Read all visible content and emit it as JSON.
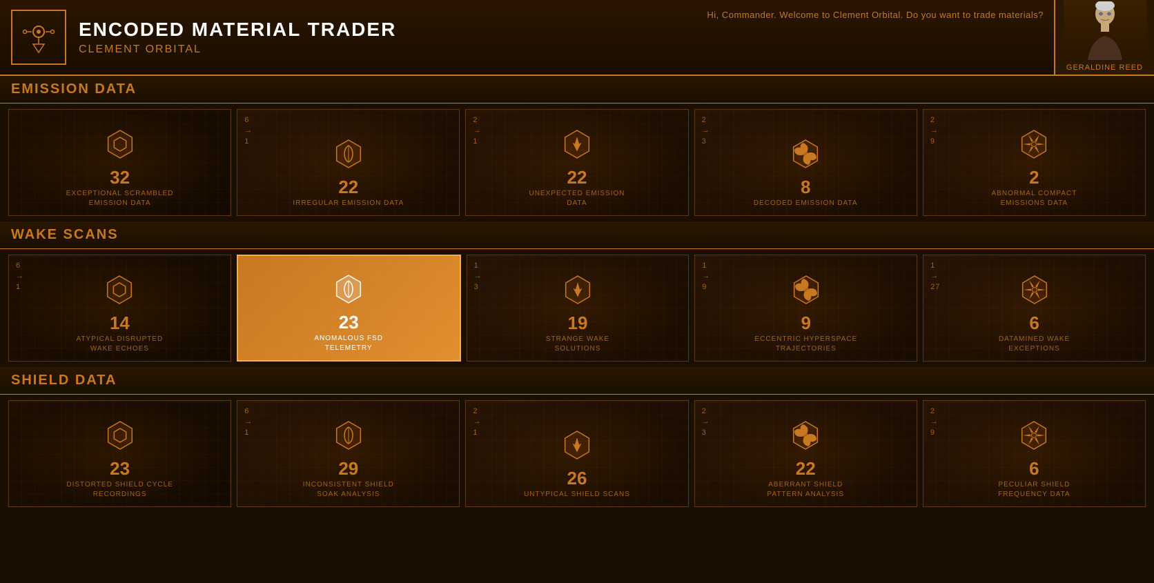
{
  "header": {
    "title": "ENCODED MATERIAL TRADER",
    "subtitle": "CLEMENT ORBITAL",
    "greeting": "Hi, Commander. Welcome to Clement Orbital. Do you want to trade materials?",
    "npc_name": "GERALDINE REED",
    "logo_label": "encoded-material-trader-logo"
  },
  "sections": [
    {
      "id": "emission-data",
      "label": "EMISSION DATA",
      "cards": [
        {
          "id": "exceptional-scrambled",
          "number": "32",
          "label": "EXCEPTIONAL SCRAMBLED\nEMISSION DATA",
          "ratio_top": "",
          "ratio_bottom": "",
          "icon_type": "hex-plain",
          "active": false
        },
        {
          "id": "irregular-emission",
          "number": "22",
          "label": "IRREGULAR EMISSION DATA",
          "ratio_top": "6",
          "ratio_bottom": "1",
          "icon_type": "hex-leaf",
          "active": false
        },
        {
          "id": "unexpected-emission",
          "number": "22",
          "label": "UNEXPECTED EMISSION\nDATA",
          "ratio_top": "2",
          "ratio_bottom": "1",
          "icon_type": "hex-flame",
          "active": false
        },
        {
          "id": "decoded-emission",
          "number": "8",
          "label": "DECODED EMISSION DATA",
          "ratio_top": "2",
          "ratio_bottom": "3",
          "icon_type": "hex-fan4",
          "active": false
        },
        {
          "id": "abnormal-compact",
          "number": "2",
          "label": "ABNORMAL COMPACT\nEMISSIONS DATA",
          "ratio_top": "2",
          "ratio_bottom": "9",
          "icon_type": "hex-fan6",
          "active": false
        }
      ]
    },
    {
      "id": "wake-scans",
      "label": "WAKE SCANS",
      "cards": [
        {
          "id": "atypical-disrupted",
          "number": "14",
          "label": "ATYPICAL DISRUPTED\nWAKE ECHOES",
          "ratio_top": "6",
          "ratio_bottom": "1",
          "icon_type": "hex-plain",
          "active": false
        },
        {
          "id": "anomalous-fsd",
          "number": "23",
          "label": "ANOMALOUS FSD\nTELEMETRY",
          "ratio_top": "",
          "ratio_bottom": "",
          "icon_type": "hex-leaf",
          "active": true
        },
        {
          "id": "strange-wake",
          "number": "19",
          "label": "STRANGE WAKE\nSOLUTIONS",
          "ratio_top": "1",
          "ratio_bottom": "3",
          "icon_type": "hex-flame",
          "active": false
        },
        {
          "id": "eccentric-hyperspace",
          "number": "9",
          "label": "ECCENTRIC HYPERSPACE\nTRAJECTORIES",
          "ratio_top": "1",
          "ratio_bottom": "9",
          "icon_type": "hex-fan4",
          "active": false
        },
        {
          "id": "datamined-wake",
          "number": "6",
          "label": "DATAMINED WAKE\nEXCEPTIONS",
          "ratio_top": "1",
          "ratio_bottom": "27",
          "icon_type": "hex-fan6",
          "active": false
        }
      ]
    },
    {
      "id": "shield-data",
      "label": "SHIELD DATA",
      "cards": [
        {
          "id": "distorted-shield",
          "number": "23",
          "label": "DISTORTED SHIELD CYCLE\nRECORDINGS",
          "ratio_top": "",
          "ratio_bottom": "",
          "icon_type": "hex-plain",
          "active": false
        },
        {
          "id": "inconsistent-shield",
          "number": "29",
          "label": "INCONSISTENT SHIELD\nSOAK ANALYSIS",
          "ratio_top": "6",
          "ratio_bottom": "1",
          "icon_type": "hex-leaf",
          "active": false
        },
        {
          "id": "untypical-shield",
          "number": "26",
          "label": "UNTYPICAL SHIELD SCANS",
          "ratio_top": "2",
          "ratio_bottom": "1",
          "icon_type": "hex-flame",
          "active": false
        },
        {
          "id": "aberrant-shield",
          "number": "22",
          "label": "ABERRANT SHIELD\nPATTERN ANALYSIS",
          "ratio_top": "2",
          "ratio_bottom": "3",
          "icon_type": "hex-fan4",
          "active": false
        },
        {
          "id": "peculiar-shield",
          "number": "6",
          "label": "PECULIAR SHIELD\nFREQUENCY DATA",
          "ratio_top": "2",
          "ratio_bottom": "9",
          "icon_type": "hex-fan6",
          "active": false
        }
      ]
    }
  ]
}
